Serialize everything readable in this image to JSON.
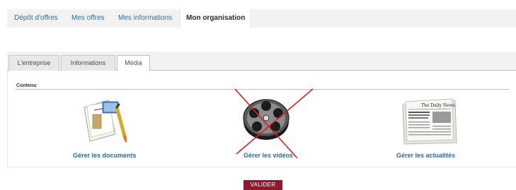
{
  "topnav": {
    "items": [
      {
        "label": "Dépôt d'offres",
        "active": false
      },
      {
        "label": "Mes offres",
        "active": false
      },
      {
        "label": "Mes informations",
        "active": false
      },
      {
        "label": "Mon organisation",
        "active": true
      }
    ]
  },
  "subtabs": {
    "items": [
      {
        "label": "L'entreprise",
        "active": false
      },
      {
        "label": "Informations",
        "active": false
      },
      {
        "label": "Média",
        "active": true
      }
    ]
  },
  "section": {
    "title": "Contenu"
  },
  "items": [
    {
      "label": "Gérer les documents",
      "icon": "documents-icon"
    },
    {
      "label": "Gérer les vidéos",
      "icon": "film-reel-icon",
      "crossed_out": true
    },
    {
      "label": "Gérer les actualités",
      "icon": "newspaper-icon"
    }
  ],
  "newspaper_masthead": "The Daily News",
  "submit": {
    "label": "VALIDER"
  },
  "colors": {
    "link": "#2c6aa0",
    "submit_bg": "#8a1a2e",
    "cross": "#d42020"
  }
}
